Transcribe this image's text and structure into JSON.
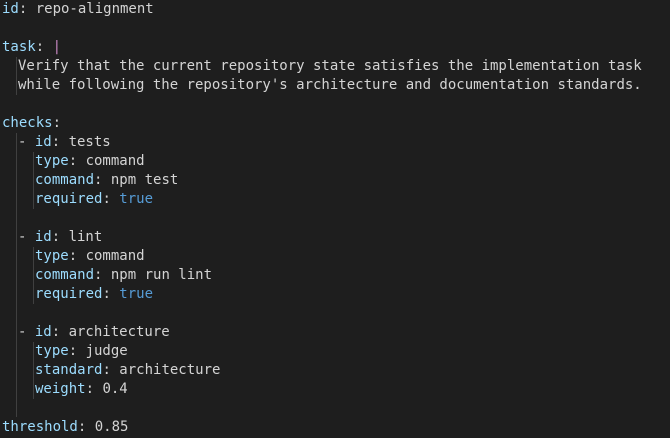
{
  "document": {
    "id_key": "id",
    "id_value": "repo-alignment",
    "task_key": "task",
    "task_indicator": "|",
    "task_lines": [
      "Verify that the current repository state satisfies the implementation task",
      "while following the repository's architecture and documentation standards."
    ],
    "checks_key": "checks",
    "checks": [
      {
        "id_key": "id",
        "id_value": "tests",
        "fields": [
          {
            "key": "type",
            "value": "command",
            "kind": "str"
          },
          {
            "key": "command",
            "value": "npm test",
            "kind": "str"
          },
          {
            "key": "required",
            "value": "true",
            "kind": "bool"
          }
        ]
      },
      {
        "id_key": "id",
        "id_value": "lint",
        "fields": [
          {
            "key": "type",
            "value": "command",
            "kind": "str"
          },
          {
            "key": "command",
            "value": "npm run lint",
            "kind": "str"
          },
          {
            "key": "required",
            "value": "true",
            "kind": "bool"
          }
        ]
      },
      {
        "id_key": "id",
        "id_value": "architecture",
        "fields": [
          {
            "key": "type",
            "value": "judge",
            "kind": "str"
          },
          {
            "key": "standard",
            "value": "architecture",
            "kind": "str"
          },
          {
            "key": "weight",
            "value": "0.4",
            "kind": "num"
          }
        ]
      }
    ],
    "threshold_key": "threshold",
    "threshold_value": "0.85"
  },
  "colors": {
    "background": "#1e1e1e",
    "key": "#9cdcfe",
    "text": "#d4d4d4",
    "boolean": "#569cd6",
    "block_indicator": "#c586c0"
  }
}
